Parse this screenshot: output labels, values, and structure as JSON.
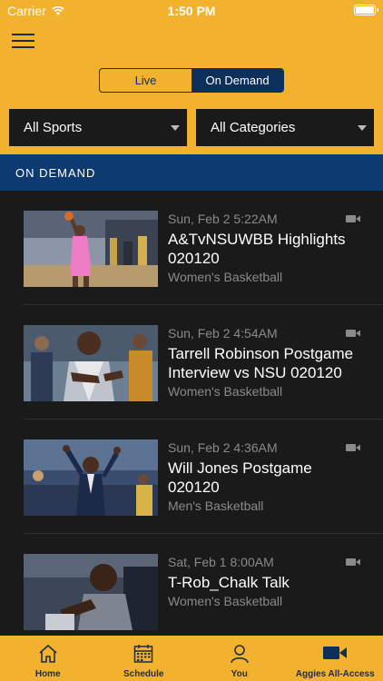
{
  "status_bar": {
    "carrier": "Carrier",
    "time": "1:50 PM"
  },
  "segment": {
    "live_label": "Live",
    "on_demand_label": "On Demand",
    "selected": "On Demand"
  },
  "filters": {
    "sports_value": "All Sports",
    "categories_value": "All Categories"
  },
  "section": {
    "title": "ON DEMAND"
  },
  "items": [
    {
      "date": "Sun, Feb 2 5:22AM",
      "title": "A&TvNSUWBB Highlights 020120",
      "category": "Women's Basketball",
      "thumbnail": "women-basketball-player-shooting",
      "icon": "video-camera-icon"
    },
    {
      "date": "Sun, Feb 2 4:54AM",
      "title": "Tarrell Robinson Postgame Interview vs NSU 020120",
      "category": "Women's Basketball",
      "thumbnail": "coach-clapping-sideline",
      "icon": "video-camera-icon"
    },
    {
      "date": "Sun, Feb 2 4:36AM",
      "title": "Will Jones Postgame 020120",
      "category": "Men's Basketball",
      "thumbnail": "coach-arms-raised-courtside",
      "icon": "video-camera-icon"
    },
    {
      "date": "Sat, Feb 1 8:00AM",
      "title": "T-Rob_Chalk Talk",
      "category": "Women's Basketball",
      "thumbnail": "coach-seated-closeup",
      "icon": "video-camera-icon"
    }
  ],
  "tabs": [
    {
      "label": "Home",
      "icon": "home-icon"
    },
    {
      "label": "Schedule",
      "icon": "calendar-icon"
    },
    {
      "label": "You",
      "icon": "person-icon"
    },
    {
      "label": "Aggies All-Access",
      "icon": "video-camera-icon",
      "active": true
    }
  ],
  "colors": {
    "gold": "#f2b22e",
    "navy": "#0d2f5c",
    "section_blue": "#0d3a70",
    "background": "#1a1a1a"
  }
}
